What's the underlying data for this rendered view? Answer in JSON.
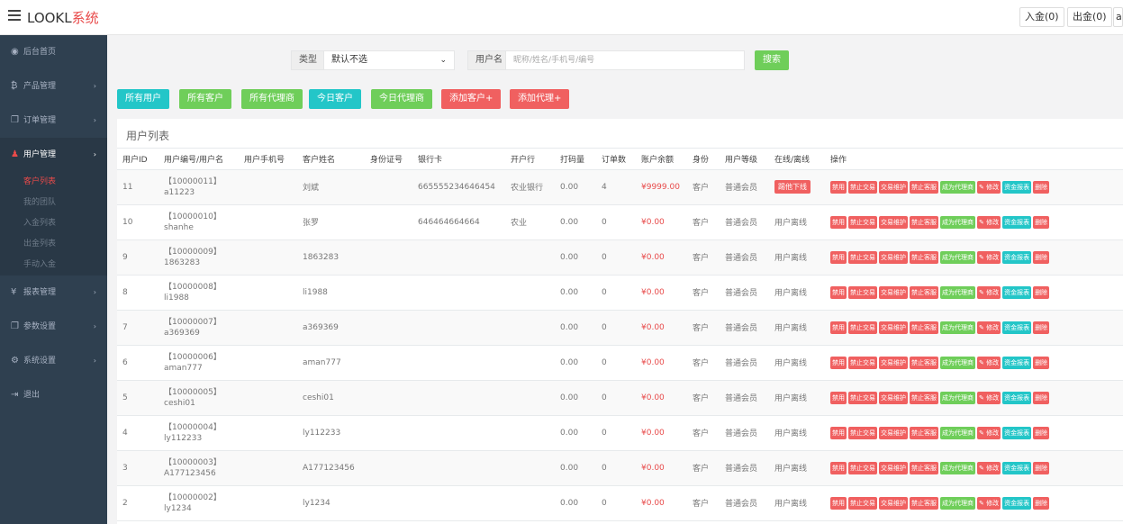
{
  "header": {
    "brand_main": "LOOKL",
    "brand_accent": "系统",
    "deposit_label": "入金(0)",
    "withdraw_label": "出金(0)",
    "extra_label": "a"
  },
  "sidebar": {
    "items": [
      {
        "icon": "dashboard-icon",
        "label": "后台首页"
      },
      {
        "icon": "coin-icon",
        "label": "产品管理"
      },
      {
        "icon": "copy-icon",
        "label": "订单管理"
      },
      {
        "icon": "user-icon",
        "label": "用户管理"
      },
      {
        "icon": "yen-icon",
        "label": "报表管理"
      },
      {
        "icon": "copy-icon",
        "label": "参数设置"
      },
      {
        "icon": "gears-icon",
        "label": "系统设置"
      },
      {
        "icon": "logout-icon",
        "label": "退出"
      }
    ],
    "sub_items": [
      "客户列表",
      "我的团队",
      "入金列表",
      "出金列表",
      "手动入金"
    ]
  },
  "filter": {
    "type_label": "类型",
    "type_value": "默认不选",
    "user_label": "用户名",
    "user_placeholder": "昵称/姓名/手机号/编号",
    "search_label": "搜索"
  },
  "quick_buttons": [
    "所有用户",
    "所有客户",
    "所有代理商",
    "今日客户",
    "今日代理商",
    "添加客户+",
    "添加代理+"
  ],
  "panel": {
    "title": "用户列表",
    "columns": [
      "用户ID",
      "用户编号/用户名",
      "用户手机号",
      "客户姓名",
      "身份证号",
      "银行卡",
      "开户行",
      "打码量",
      "订单数",
      "账户余额",
      "身份",
      "用户等级",
      "在线/离线",
      "操作"
    ],
    "actions": [
      "禁用",
      "禁止交易",
      "交易维护",
      "禁止客服",
      "成为代理商",
      "✎ 修改",
      "资金报表",
      "删除"
    ],
    "rows": [
      {
        "id": "11",
        "code": "【10000011】",
        "username": "a11223",
        "phone": "",
        "name": "刘斌",
        "idcard": "",
        "card": "665555234646454",
        "bank": "农业银行",
        "flow": "0.00",
        "orders": "4",
        "balance": "¥9999.00",
        "role": "客户",
        "level": "普通会员",
        "status": "踢他下线"
      },
      {
        "id": "10",
        "code": "【10000010】",
        "username": "shanhe",
        "phone": "",
        "name": "张罗",
        "idcard": "",
        "card": "646464664664",
        "bank": "农业",
        "flow": "0.00",
        "orders": "0",
        "balance": "¥0.00",
        "role": "客户",
        "level": "普通会员",
        "status": "用户离线"
      },
      {
        "id": "9",
        "code": "【10000009】",
        "username": "1863283",
        "phone": "",
        "name": "1863283",
        "idcard": "",
        "card": "",
        "bank": "",
        "flow": "0.00",
        "orders": "0",
        "balance": "¥0.00",
        "role": "客户",
        "level": "普通会员",
        "status": "用户离线"
      },
      {
        "id": "8",
        "code": "【10000008】",
        "username": "li1988",
        "phone": "",
        "name": "li1988",
        "idcard": "",
        "card": "",
        "bank": "",
        "flow": "0.00",
        "orders": "0",
        "balance": "¥0.00",
        "role": "客户",
        "level": "普通会员",
        "status": "用户离线"
      },
      {
        "id": "7",
        "code": "【10000007】",
        "username": "a369369",
        "phone": "",
        "name": "a369369",
        "idcard": "",
        "card": "",
        "bank": "",
        "flow": "0.00",
        "orders": "0",
        "balance": "¥0.00",
        "role": "客户",
        "level": "普通会员",
        "status": "用户离线"
      },
      {
        "id": "6",
        "code": "【10000006】",
        "username": "aman777",
        "phone": "",
        "name": "aman777",
        "idcard": "",
        "card": "",
        "bank": "",
        "flow": "0.00",
        "orders": "0",
        "balance": "¥0.00",
        "role": "客户",
        "level": "普通会员",
        "status": "用户离线"
      },
      {
        "id": "5",
        "code": "【10000005】",
        "username": "ceshi01",
        "phone": "",
        "name": "ceshi01",
        "idcard": "",
        "card": "",
        "bank": "",
        "flow": "0.00",
        "orders": "0",
        "balance": "¥0.00",
        "role": "客户",
        "level": "普通会员",
        "status": "用户离线"
      },
      {
        "id": "4",
        "code": "【10000004】",
        "username": "ly112233",
        "phone": "",
        "name": "ly112233",
        "idcard": "",
        "card": "",
        "bank": "",
        "flow": "0.00",
        "orders": "0",
        "balance": "¥0.00",
        "role": "客户",
        "level": "普通会员",
        "status": "用户离线"
      },
      {
        "id": "3",
        "code": "【10000003】",
        "username": "A177123456",
        "phone": "",
        "name": "A177123456",
        "idcard": "",
        "card": "",
        "bank": "",
        "flow": "0.00",
        "orders": "0",
        "balance": "¥0.00",
        "role": "客户",
        "level": "普通会员",
        "status": "用户离线"
      },
      {
        "id": "2",
        "code": "【10000002】",
        "username": "ly1234",
        "phone": "",
        "name": "ly1234",
        "idcard": "",
        "card": "",
        "bank": "",
        "flow": "0.00",
        "orders": "0",
        "balance": "¥0.00",
        "role": "客户",
        "level": "普通会员",
        "status": "用户离线"
      }
    ]
  }
}
